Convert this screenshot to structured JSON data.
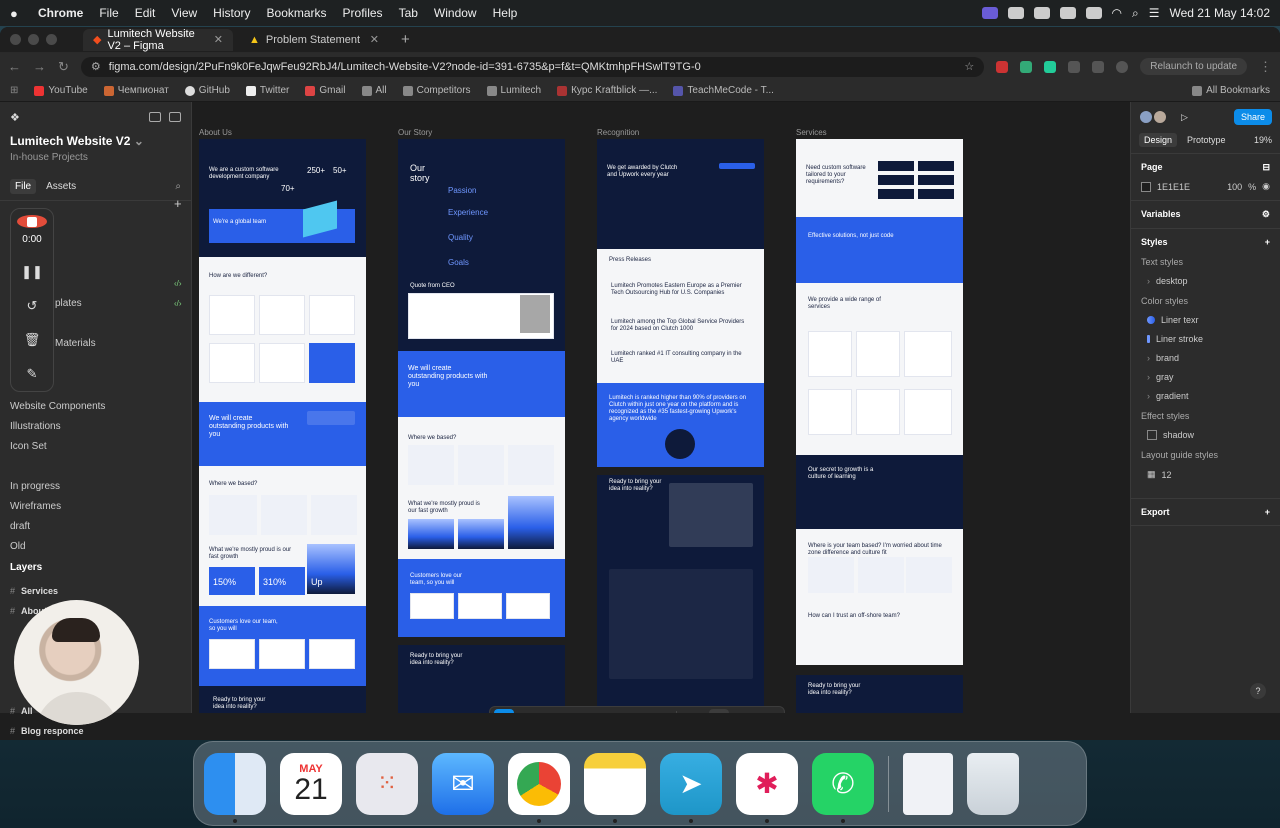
{
  "menubar": {
    "app": "Chrome",
    "items": [
      "File",
      "Edit",
      "View",
      "History",
      "Bookmarks",
      "Profiles",
      "Tab",
      "Window",
      "Help"
    ],
    "clock": "Wed 21 May  14:02"
  },
  "browser": {
    "tabs": [
      {
        "label": "Lumitech Website V2 – Figma",
        "active": true
      },
      {
        "label": "Problem Statement",
        "active": false
      }
    ],
    "url": "figma.com/design/2PuFn9k0FeJqwFeu92RbJ4/Lumitech-Website-V2?node-id=391-6735&p=f&t=QMKtmhpFHSwlT9TG-0",
    "relaunch": "Relaunch to update",
    "bookmarks": [
      "YouTube",
      "Чемпионат",
      "GitHub",
      "Twitter",
      "Gmail",
      "All",
      "Competitors",
      "Lumitech",
      "Курс Kraftblick —...",
      "TeachMeCode - T..."
    ],
    "all_bookmarks": "All Bookmarks"
  },
  "figma": {
    "project": "Lumitech Website V2",
    "team": "In-house Projects",
    "file_tab": "File",
    "assets_tab": "Assets",
    "pages": [
      "Website Components",
      "Illustrations",
      "Icon Set",
      "In progress",
      "Wireframes",
      "draft",
      "Old"
    ],
    "partial_pages": [
      "plates",
      "Materials"
    ],
    "layers_title": "Layers",
    "layers": [
      "Services",
      "About",
      "All",
      "Blog responce"
    ],
    "recorder": {
      "time": "0:00"
    },
    "frames": [
      {
        "label": "About Us"
      },
      {
        "label": "Our Story"
      },
      {
        "label": "Recognition"
      },
      {
        "label": "Services"
      }
    ],
    "frame_text": {
      "about_hero": "We are a custom software development company",
      "about_stats": [
        "250+",
        "50+",
        "70+"
      ],
      "about_team": "We're a global team",
      "about_diff": "How are we different?",
      "about_create": "We will create outstanding products with you",
      "about_based": "Where we based?",
      "about_proud": "What we're mostly proud is our fast growth",
      "about_nums": [
        "150%",
        "310%",
        "Up"
      ],
      "about_customers": "Customers love our team, so you will",
      "about_ready": "Ready to bring your idea into reality?",
      "story_title": "Our story",
      "story_words": [
        "Passion",
        "Experience",
        "Quality",
        "Goals"
      ],
      "story_quote": "Quote from CEO",
      "story_create": "We will create outstanding products with you",
      "story_based": "Where we based?",
      "story_proud": "What we're mostly proud is our fast growth",
      "story_customers": "Customers love our team, so you will",
      "story_ready": "Ready to bring your idea into reality?",
      "rec_hero": "We get awarded by Clutch and Upwork every year",
      "rec_press": "Press Releases",
      "rec_pr1": "Lumitech Promotes Eastern Europe as a Premier Tech Outsourcing Hub for U.S. Companies",
      "rec_pr2": "Lumitech among the Top Global Service Providers for 2024 based on Clutch 1000",
      "rec_pr3": "Lumitech ranked #1 IT consulting company in the UAE",
      "rec_upwork": "Lumitech is ranked higher than 90% of providers on Clutch within just one year on the platform and is recognized as the #35 fastest-growing Upwork's agency worldwide",
      "rec_ready": "Ready to bring your idea into reality?",
      "svc_hero": "Need custom software tailored to your requirements?",
      "svc_effective": "Effective solutions, not just code",
      "svc_range": "We provide a wide range of services",
      "svc_growth": "Our secret to growth is a culture of learning",
      "svc_team": "Where is your team based? I'm worried about time zone difference and culture fit",
      "svc_trust": "How can I trust an off-shore team?",
      "svc_ready": "Ready to bring your idea into reality?"
    },
    "right": {
      "share": "Share",
      "design": "Design",
      "prototype": "Prototype",
      "zoom": "19%",
      "page": "Page",
      "page_color": "1E1E1E",
      "page_opacity": "100",
      "page_unit": "%",
      "variables": "Variables",
      "styles": "Styles",
      "text_styles": "Text styles",
      "desktop": "desktop",
      "color_styles": "Color styles",
      "colors": [
        "Liner texr",
        "Liner stroke",
        "brand",
        "gray",
        "gradient"
      ],
      "effect_styles": "Effect styles",
      "shadow": "shadow",
      "layout_guide": "Layout guide styles",
      "grid": "12",
      "export": "Export"
    }
  },
  "dock": {
    "calendar_month": "MAY",
    "calendar_day": "21"
  },
  "colors": {
    "accent": "#0c8ce9",
    "brand_blue": "#2a5fe8",
    "dark_navy": "#0e1a3a"
  }
}
